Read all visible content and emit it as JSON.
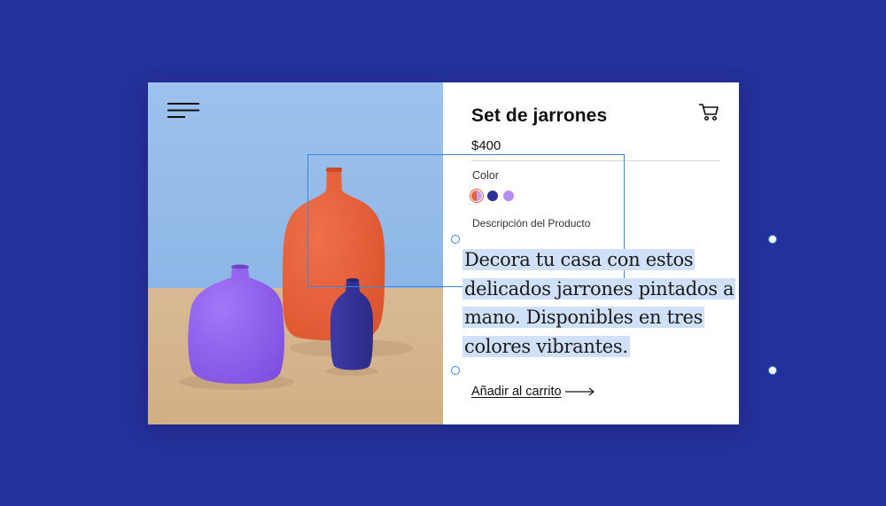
{
  "product": {
    "title": "Set de jarrones",
    "price": "$400",
    "color_label": "Color",
    "swatches": [
      {
        "name": "coral",
        "color": "#e8603c",
        "selected": true
      },
      {
        "name": "navy",
        "color": "#2b2f9a",
        "selected": false
      },
      {
        "name": "lavender",
        "color": "#b48cf5",
        "selected": false
      }
    ],
    "description_label": "Descripción del Producto",
    "description": "Decora tu casa con estos delicados jarrones pintados a mano. Disponibles en tres colores vibrantes.",
    "add_to_cart": "Añadir al carrito"
  },
  "icons": {
    "menu": "hamburger-menu-icon",
    "cart": "shopping-cart-icon",
    "arrow": "arrow-right-icon"
  },
  "colors": {
    "background": "#24309b",
    "selection": "#3a87e0",
    "highlight": "#cfe0f8"
  }
}
